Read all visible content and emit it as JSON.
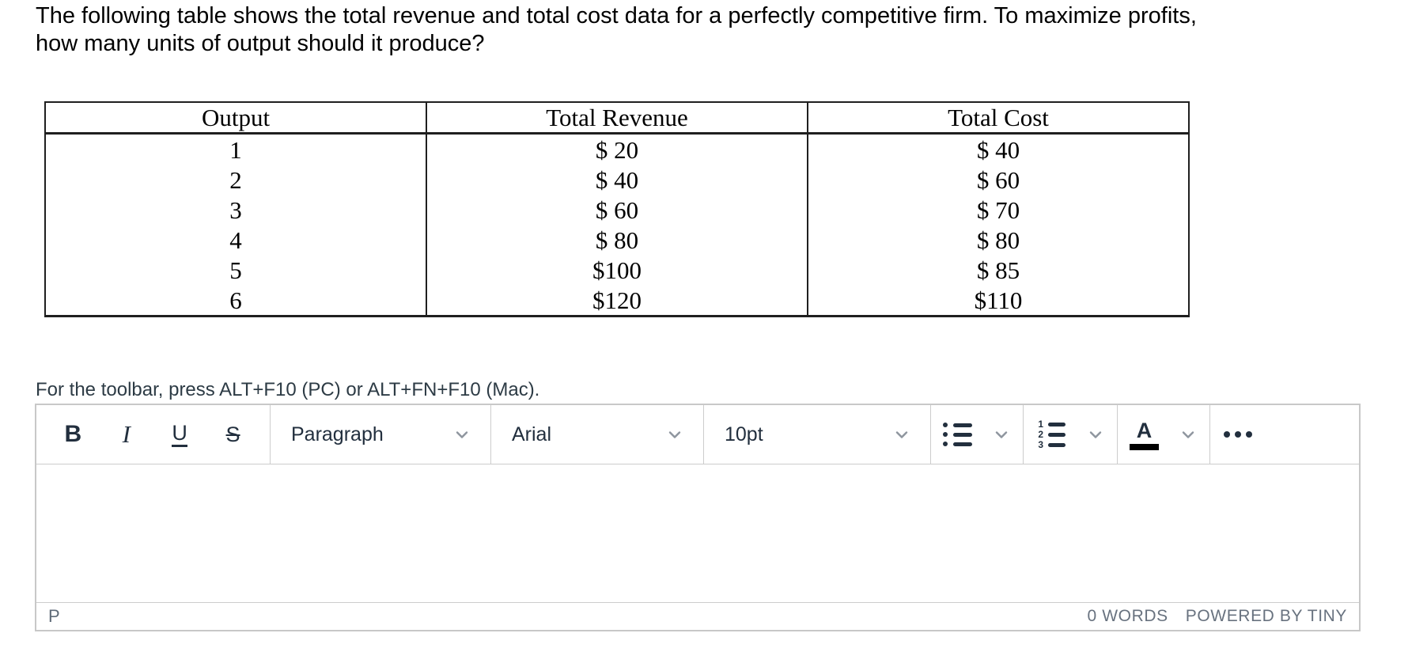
{
  "question": {
    "line1": "The following table shows the total revenue and total cost data for a perfectly competitive firm. To maximize profits,",
    "line2": "how many units of output should it produce?"
  },
  "table": {
    "columns": [
      "Output",
      "Total Revenue",
      "Total Cost"
    ],
    "rows": [
      [
        "1",
        "$ 20",
        "$ 40"
      ],
      [
        "2",
        "$ 40",
        "$ 60"
      ],
      [
        "3",
        "$ 60",
        "$ 70"
      ],
      [
        "4",
        "$ 80",
        "$ 80"
      ],
      [
        "5",
        "$100",
        "$ 85"
      ],
      [
        "6",
        "$120",
        "$110"
      ]
    ]
  },
  "toolbar_hint": "For the toolbar, press ALT+F10 (PC) or ALT+FN+F10 (Mac).",
  "editor": {
    "toolbar": {
      "bold": "B",
      "italic": "I",
      "underline": "U",
      "strikethrough": "S",
      "paragraph_format": "Paragraph",
      "font_family": "Arial",
      "font_size": "10pt",
      "forecolor": "A"
    },
    "statusbar": {
      "element_path": "P",
      "word_count": "0 WORDS",
      "branding": "POWERED BY TINY"
    }
  },
  "colors": {
    "toolbar_icon": "#222f3e",
    "chevron": "#8e959e",
    "editor_border": "#c8c8c8",
    "divider": "#cccccc",
    "status_text": "#68727f",
    "table_border": "#1f1f1f",
    "forecolor_current": "#000000"
  }
}
